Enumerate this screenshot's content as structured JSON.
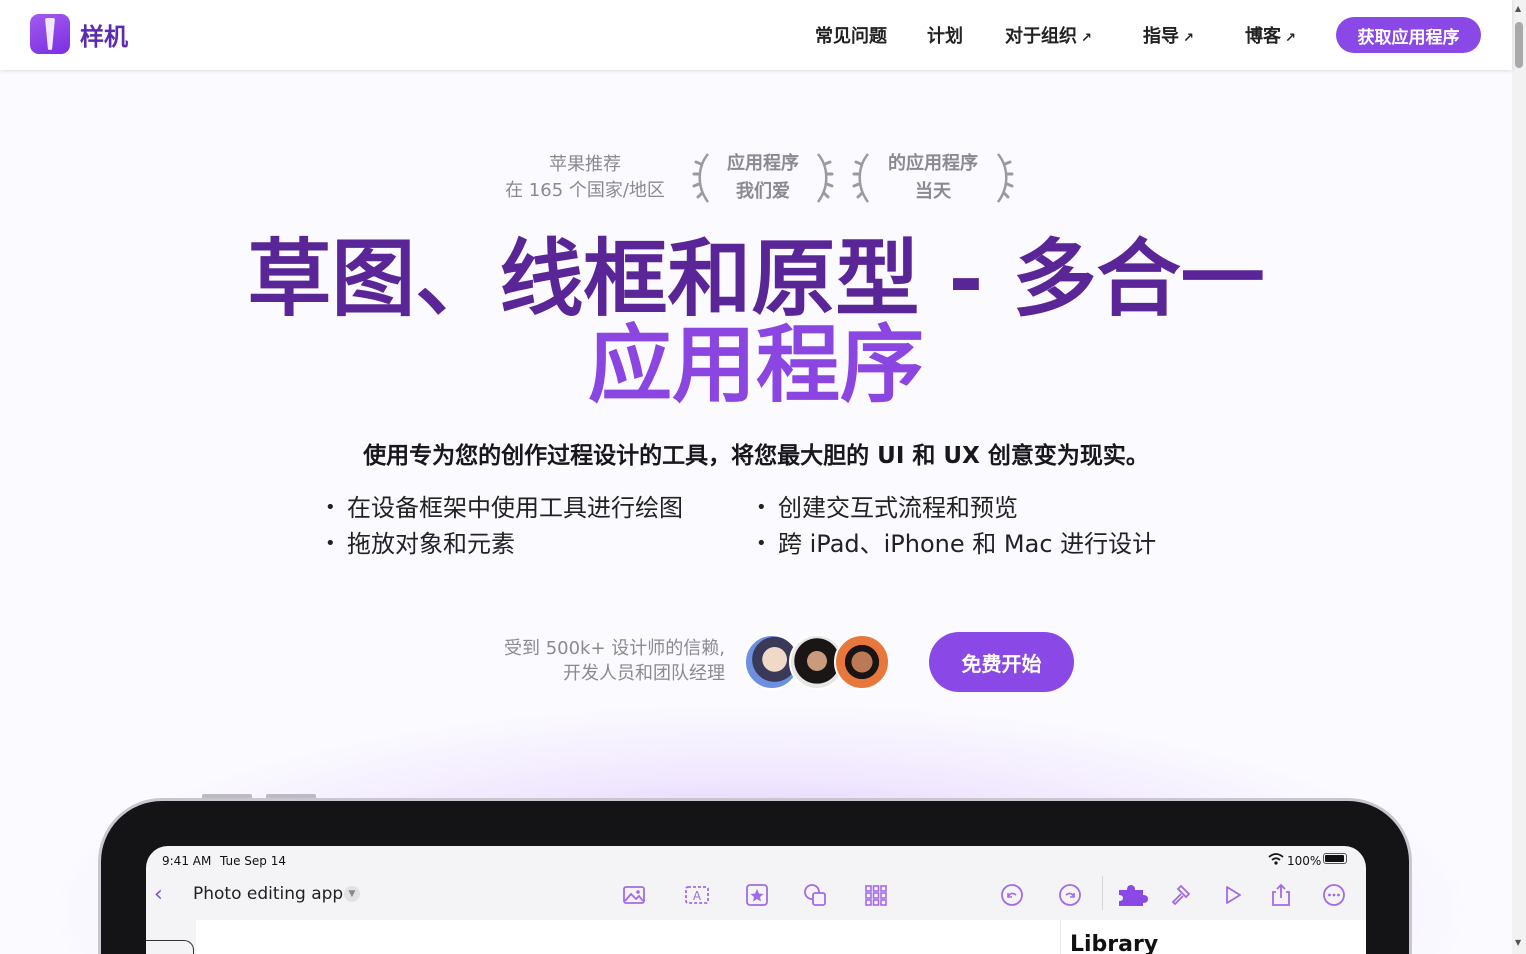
{
  "header": {
    "logo_text": "样机",
    "nav": [
      {
        "label": "常见问题",
        "external": false
      },
      {
        "label": "计划",
        "external": false
      },
      {
        "label": "对于组织",
        "external": true
      },
      {
        "label": "指导",
        "external": true
      },
      {
        "label": "博客",
        "external": true
      }
    ],
    "external_arrow": "↗",
    "cta_label": "获取应用程序",
    "accent_color": "#8a48e6"
  },
  "awards": {
    "featured_line1": "苹果推荐",
    "featured_line2": "在 165 个国家/地区",
    "award1_line1": "应用程序",
    "award1_line2": "我们爱",
    "award2_line1": "的应用程序",
    "award2_line2": "当天"
  },
  "hero": {
    "headline_line1": "草图、线框和原型 - 多合一",
    "headline_line2": "应用程序",
    "subheadline": "使用专为您的创作过程设计的工具，将您最大胆的 UI 和 UX 创意变为现实。",
    "features_left": [
      "在设备框架中使用工具进行绘图",
      "拖放对象和元素"
    ],
    "features_right": [
      "创建交互式流程和预览",
      "跨 iPad、iPhone 和 Mac 进行设计"
    ],
    "trust_line1": "受到 500k+ 设计师的信赖,",
    "trust_line2": "开发人员和团队经理",
    "cta_label": "免费开始"
  },
  "ipad": {
    "time": "9:41 AM",
    "date": "Tue Sep 14",
    "battery": "100%",
    "doc_title": "Photo editing app",
    "library_label": "Library",
    "tools_center": [
      "image-icon",
      "text-box-icon",
      "star-box-icon",
      "shapes-icon",
      "grid-icon"
    ],
    "tools_right": [
      "undo-icon",
      "redo-icon",
      "puzzle-icon",
      "hammer-icon",
      "play-icon",
      "share-icon",
      "more-icon"
    ]
  }
}
